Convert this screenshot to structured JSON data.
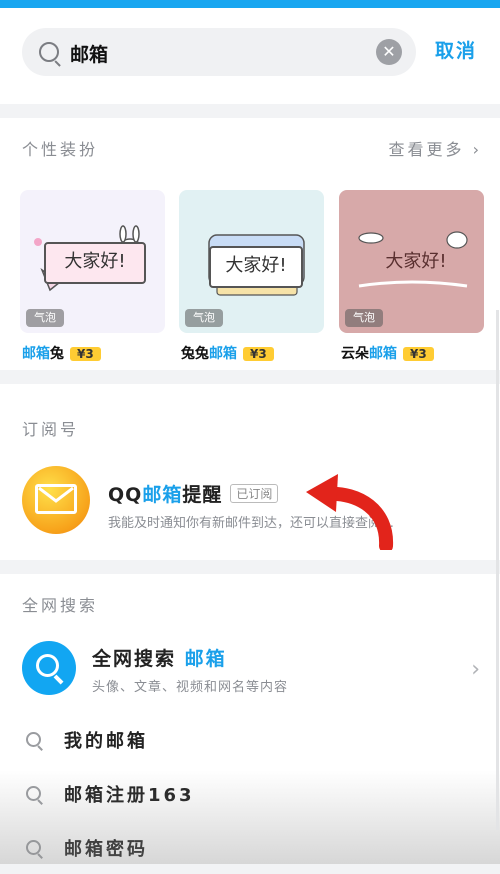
{
  "search": {
    "query": "邮箱",
    "clear_symbol": "✕",
    "cancel_label": "取消"
  },
  "decor": {
    "title": "个性装扮",
    "more": "查看更多",
    "items": [
      {
        "bubble": "大家好!",
        "tag": "气泡",
        "name_pre": "",
        "name_hl": "邮箱",
        "name_post": "兔",
        "price": "¥3",
        "bg": "#f4f2fb"
      },
      {
        "bubble": "大家好!",
        "tag": "气泡",
        "name_pre": "兔兔",
        "name_hl": "邮箱",
        "name_post": "",
        "price": "¥3",
        "bg": "#e1f1f3"
      },
      {
        "bubble": "大家好!",
        "tag": "气泡",
        "name_pre": "云朵",
        "name_hl": "邮箱",
        "name_post": "",
        "price": "¥3",
        "bg": "#d7a9a9"
      }
    ]
  },
  "subscriptions": {
    "title": "订阅号",
    "item": {
      "name_pre": "QQ",
      "name_hl": "邮箱",
      "name_post": "提醒",
      "badge": "已订阅",
      "desc": "我能及时通知你有新邮件到达，还可以直接查阅…"
    }
  },
  "web_search": {
    "title": "全网搜索",
    "main_label": "全网搜索",
    "main_hl": "邮箱",
    "sub": "头像、文章、视频和网名等内容",
    "suggestions": [
      "我的邮箱",
      "邮箱注册163",
      "邮箱密码"
    ]
  },
  "colors": {
    "accent": "#1aa0ea",
    "price_bg": "#ffcc33",
    "arrow": "#e2241b"
  }
}
